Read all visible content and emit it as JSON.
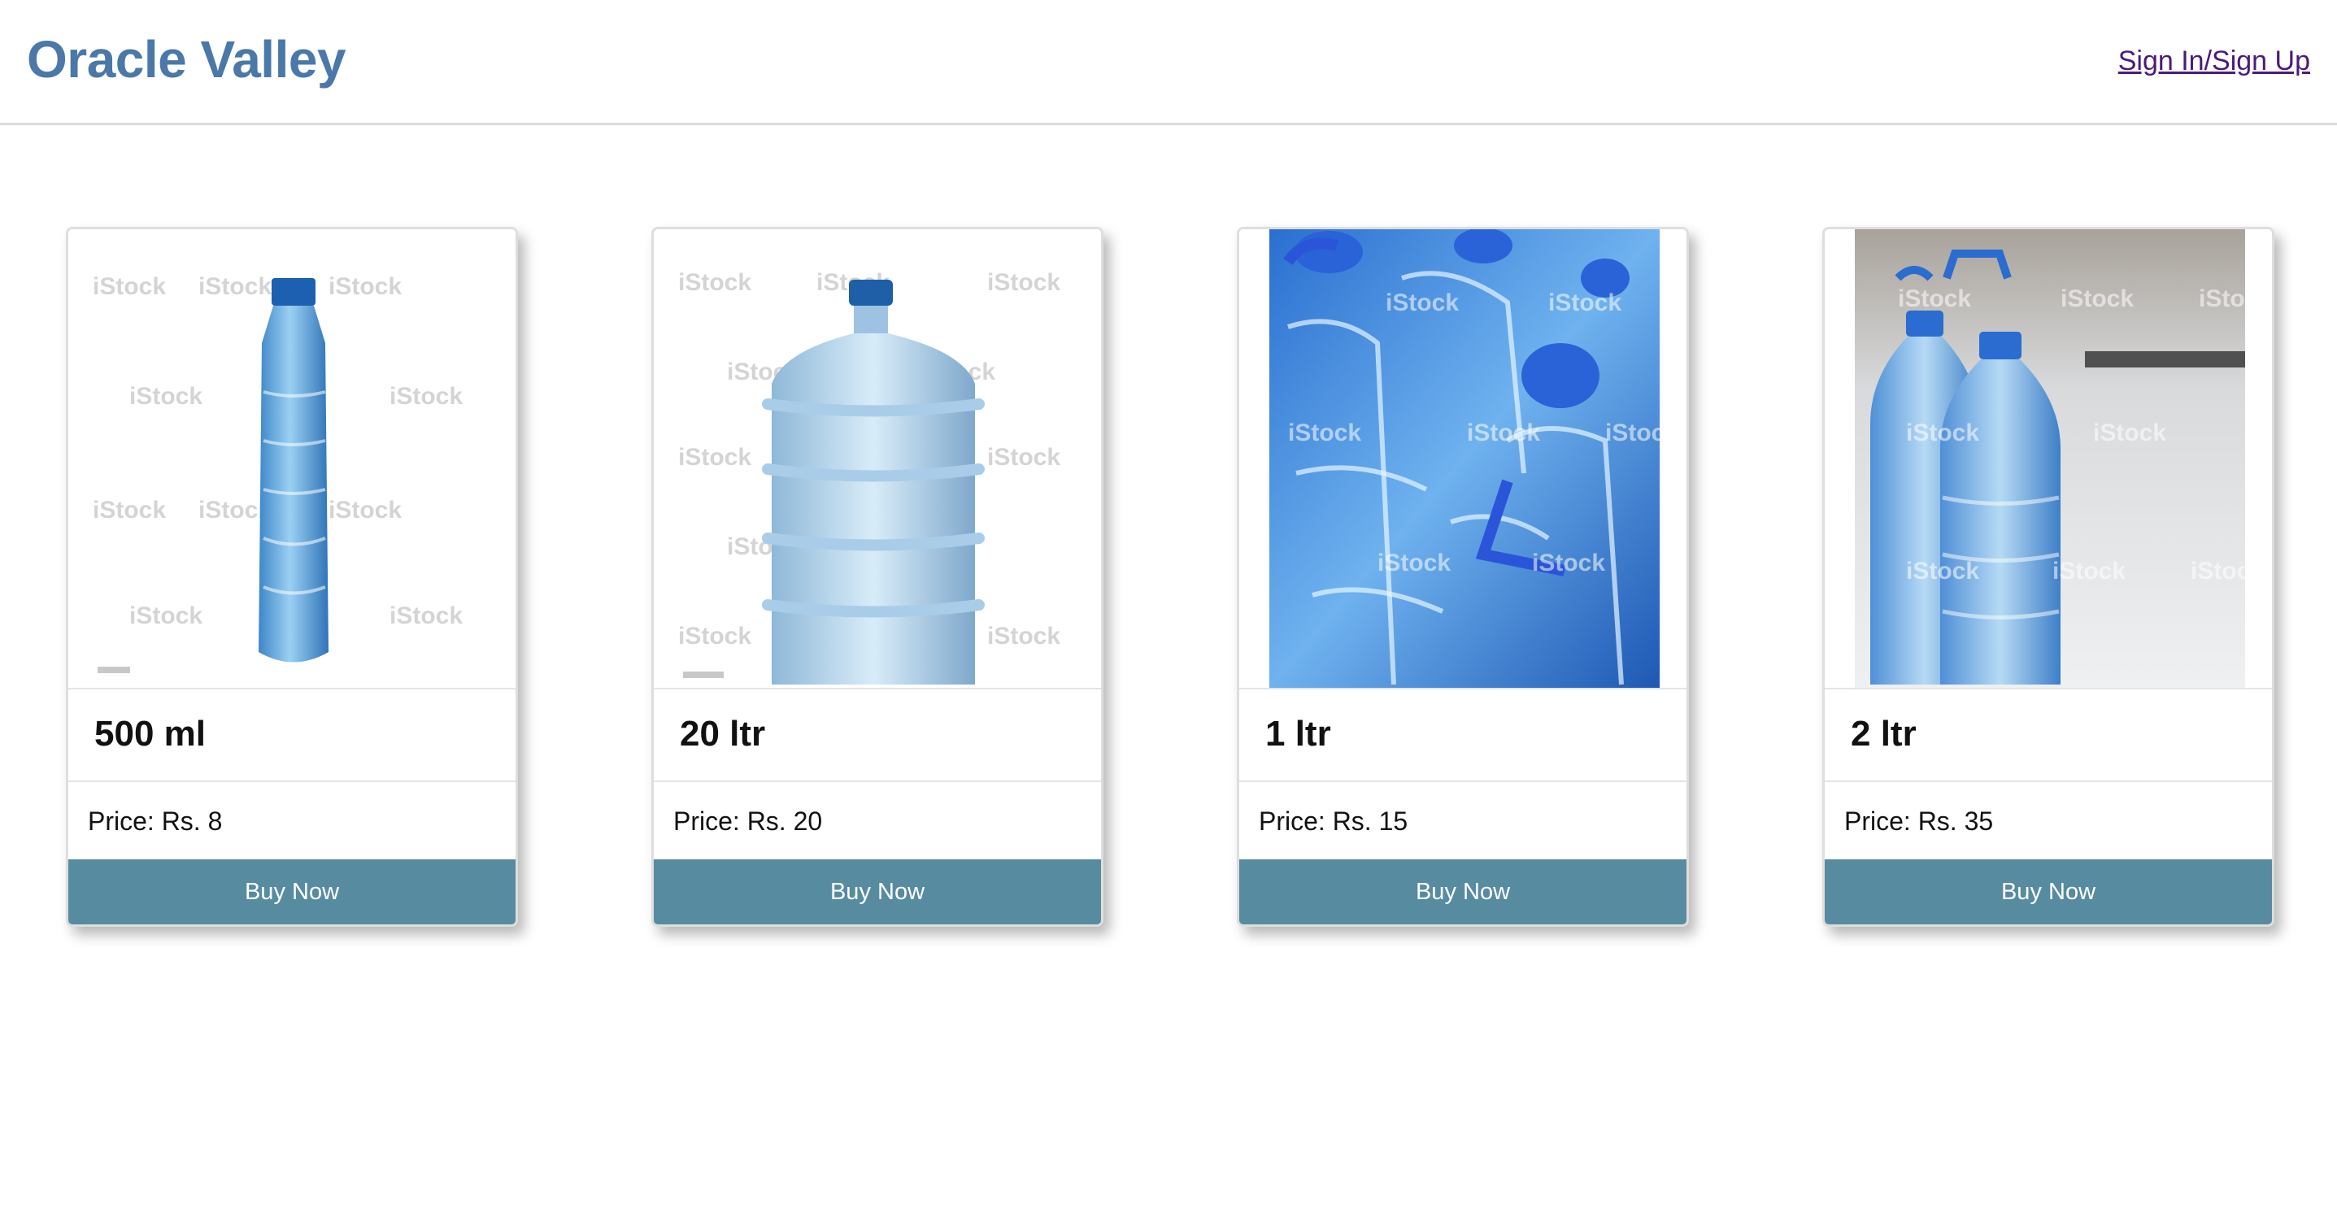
{
  "header": {
    "brand": "Oracle Valley",
    "signin_label": "Sign In/Sign Up"
  },
  "watermark": "iStock",
  "products": [
    {
      "name": "500 ml",
      "price": "Price: Rs. 8",
      "button": "Buy Now",
      "image": "small-bottle-image"
    },
    {
      "name": "20 ltr",
      "price": "Price: Rs. 20",
      "button": "Buy Now",
      "image": "water-jar-image"
    },
    {
      "name": "1 ltr",
      "price": "Price: Rs. 15",
      "button": "Buy Now",
      "image": "bottles-pile-image"
    },
    {
      "name": "2 ltr",
      "price": "Price: Rs. 35",
      "button": "Buy Now",
      "image": "two-bottles-image"
    }
  ],
  "colors": {
    "brand": "#4a78a8",
    "button": "#578ba0",
    "link": "#4b1a7a"
  }
}
